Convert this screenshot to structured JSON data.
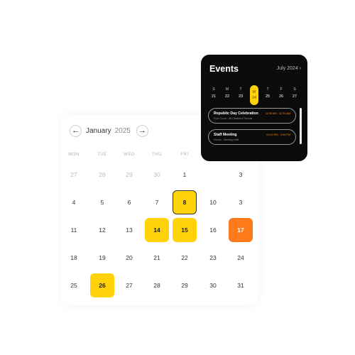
{
  "calendar": {
    "month": "January",
    "year": "2025",
    "prev_icon": "arrow-left-icon",
    "next_icon": "arrow-right-icon",
    "prev_glyph": "←",
    "next_glyph": "→",
    "weekdays": [
      "MON",
      "TUE",
      "WED",
      "THU",
      "FRI"
    ],
    "weeks": [
      [
        "27",
        "28",
        "29",
        "30",
        "1",
        "3"
      ],
      [
        "4",
        "5",
        "6",
        "7",
        "8",
        "10"
      ],
      [
        "11",
        "12",
        "13",
        "14",
        "15",
        "16",
        "17"
      ],
      [
        "18",
        "19",
        "20",
        "21",
        "22",
        "23",
        "24"
      ],
      [
        "25",
        "26",
        "27",
        "28",
        "29",
        "30",
        "31"
      ]
    ]
  },
  "events_panel": {
    "title": "Events",
    "month_label": "July 2024 ›",
    "week": [
      {
        "day": "S",
        "date": "21"
      },
      {
        "day": "M",
        "date": "22"
      },
      {
        "day": "T",
        "date": "23"
      },
      {
        "day": "W",
        "date": "24"
      },
      {
        "day": "T",
        "date": "25"
      },
      {
        "day": "F",
        "date": "26"
      },
      {
        "day": "S",
        "date": "27"
      }
    ],
    "events": [
      {
        "name": "Republic Day Celebration",
        "location": "Foot Court - 4th Seabird Thenali",
        "time": "11:00 AM - 12:30 AM"
      },
      {
        "name": "Staff Meeting",
        "location": "Venue - Meeting Hall",
        "time": "01:00 PM - 2:00 PM"
      }
    ]
  },
  "colors": {
    "highlight_yellow": "#ffd20a",
    "highlight_orange": "#ff7a1a",
    "events_bg": "#0b0b0b",
    "event_time": "#ff8a1e"
  }
}
